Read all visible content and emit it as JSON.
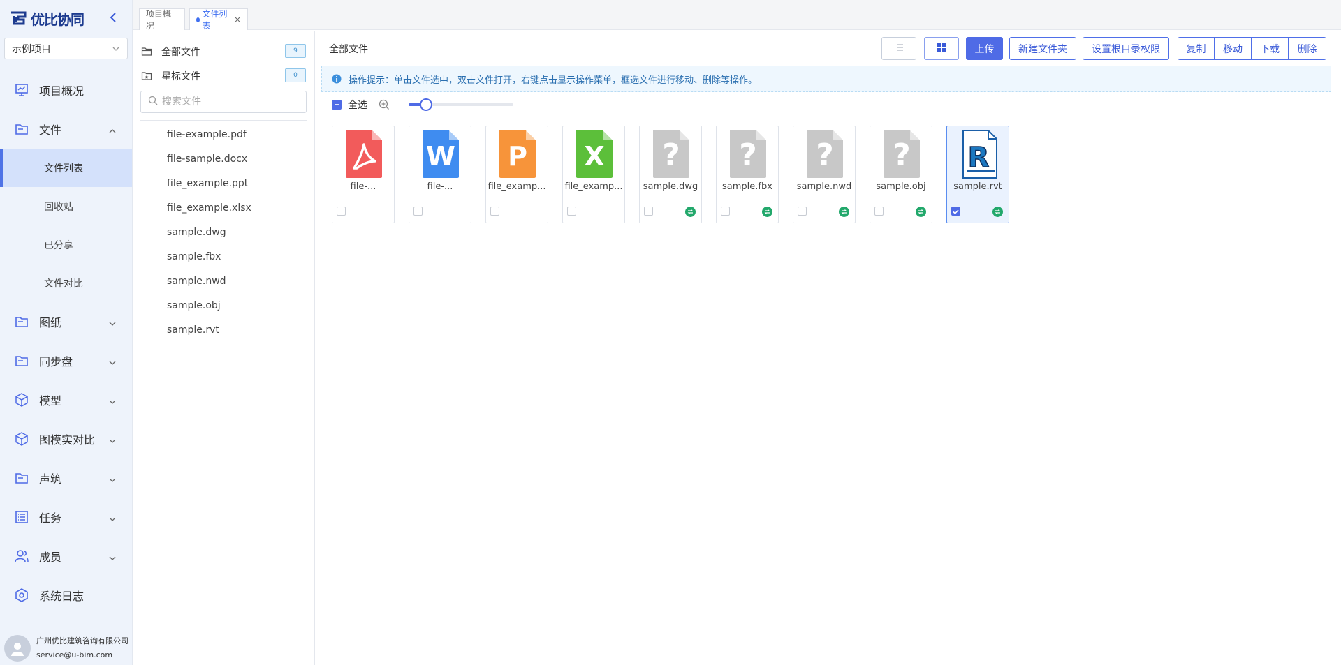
{
  "app": {
    "brand": "优比协同",
    "project": "示例项目"
  },
  "nav": {
    "items": [
      {
        "label": "项目概况",
        "icon": "monitor-icon"
      },
      {
        "label": "文件",
        "icon": "folder-icon",
        "expanded": true,
        "children": [
          {
            "label": "文件列表",
            "active": true
          },
          {
            "label": "回收站"
          },
          {
            "label": "已分享"
          },
          {
            "label": "文件对比"
          }
        ]
      },
      {
        "label": "图纸",
        "icon": "drawing-folder-icon"
      },
      {
        "label": "同步盘",
        "icon": "sync-folder-icon"
      },
      {
        "label": "模型",
        "icon": "cube-icon"
      },
      {
        "label": "图模实对比",
        "icon": "cube-compare-icon"
      },
      {
        "label": "声筑",
        "icon": "sound-folder-icon"
      },
      {
        "label": "任务",
        "icon": "task-list-icon"
      },
      {
        "label": "成员",
        "icon": "members-icon"
      },
      {
        "label": "系统日志",
        "icon": "hexagon-log-icon"
      }
    ]
  },
  "user": {
    "company": "广州优比建筑咨询有限公司",
    "email": "service@u-bim.com"
  },
  "tabs": [
    {
      "label": "项目概况"
    },
    {
      "label": "文件列表",
      "active": true,
      "close": "×"
    }
  ],
  "folders": {
    "all": {
      "label": "全部文件",
      "count": "9"
    },
    "starred": {
      "label": "星标文件",
      "count": "0"
    },
    "search_placeholder": "搜索文件",
    "files": [
      "file-example.pdf",
      "file-sample.docx",
      "file_example.ppt",
      "file_example.xlsx",
      "sample.dwg",
      "sample.fbx",
      "sample.nwd",
      "sample.obj",
      "sample.rvt"
    ]
  },
  "main": {
    "breadcrumb": "全部文件",
    "buttons": {
      "upload": "上传",
      "new_folder": "新建文件夹",
      "root_permission": "设置根目录权限",
      "copy": "复制",
      "move": "移动",
      "download": "下载",
      "delete": "删除"
    },
    "tip": "操作提示：单击文件选中，双击文件打开，右键点击显示操作菜单，框选文件进行移动、删除等操作。",
    "select_all": "全选",
    "zoom_level": 0.15,
    "colors": {
      "accent": "#4f6be6",
      "pdf": "#f25b5b",
      "word": "#3f8cf0",
      "ppt": "#f7943a",
      "excel": "#5cbf3a",
      "unknown": "#c8c8c8",
      "sync": "#22a86b"
    }
  },
  "cards": [
    {
      "name": "file-...",
      "type": "pdf",
      "icon": "pdf-file-icon",
      "checked": false,
      "sync": false
    },
    {
      "name": "file-...",
      "type": "word",
      "icon": "word-file-icon",
      "letter": "W",
      "checked": false,
      "sync": false
    },
    {
      "name": "file_examp...",
      "type": "ppt",
      "icon": "ppt-file-icon",
      "letter": "P",
      "checked": false,
      "sync": false
    },
    {
      "name": "file_examp...",
      "type": "excel",
      "icon": "excel-file-icon",
      "letter": "X",
      "checked": false,
      "sync": false
    },
    {
      "name": "sample.dwg",
      "type": "unknown",
      "icon": "unknown-file-icon",
      "letter": "?",
      "checked": false,
      "sync": true
    },
    {
      "name": "sample.fbx",
      "type": "unknown",
      "icon": "unknown-file-icon",
      "letter": "?",
      "checked": false,
      "sync": true
    },
    {
      "name": "sample.nwd",
      "type": "unknown",
      "icon": "unknown-file-icon",
      "letter": "?",
      "checked": false,
      "sync": true
    },
    {
      "name": "sample.obj",
      "type": "unknown",
      "icon": "unknown-file-icon",
      "letter": "?",
      "checked": false,
      "sync": true
    },
    {
      "name": "sample.rvt",
      "type": "revit",
      "icon": "revit-file-icon",
      "letter": "R",
      "checked": true,
      "sync": true
    }
  ]
}
